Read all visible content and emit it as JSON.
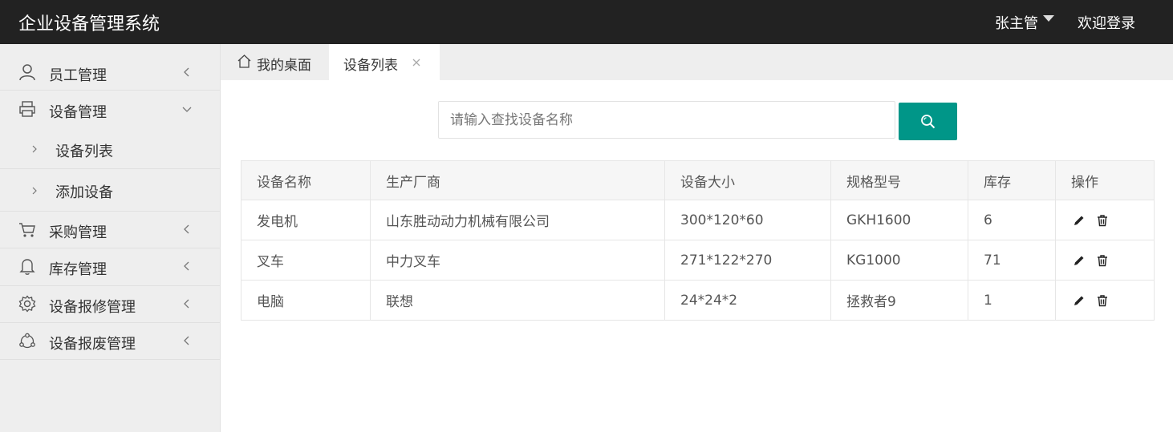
{
  "header": {
    "app_title": "企业设备管理系统",
    "user_name": "张主管",
    "welcome": "欢迎登录"
  },
  "sidebar": {
    "items": [
      {
        "label": "员工管理",
        "icon": "user-icon"
      },
      {
        "label": "设备管理",
        "icon": "printer-icon",
        "expanded": true
      },
      {
        "label": "设备列表",
        "sub": true
      },
      {
        "label": "添加设备",
        "sub": true
      },
      {
        "label": "采购管理",
        "icon": "cart-icon"
      },
      {
        "label": "库存管理",
        "icon": "bell-icon"
      },
      {
        "label": "设备报修管理",
        "icon": "gear-icon"
      },
      {
        "label": "设备报废管理",
        "icon": "share-icon"
      }
    ]
  },
  "tabs": [
    {
      "label": "我的桌面",
      "icon": "home-icon"
    },
    {
      "label": "设备列表",
      "active": true
    }
  ],
  "search": {
    "placeholder": "请输入查找设备名称",
    "button_icon": "search-icon",
    "button_color": "#009688"
  },
  "table": {
    "headers": [
      "设备名称",
      "生产厂商",
      "设备大小",
      "规格型号",
      "库存",
      "操作"
    ],
    "rows": [
      [
        "发电机",
        "山东胜动动力机械有限公司",
        "300*120*60",
        "GKH1600",
        "6"
      ],
      [
        "叉车",
        "中力叉车",
        "271*122*270",
        "KG1000",
        "71"
      ],
      [
        "电脑",
        "联想",
        "24*24*2",
        "拯救者9",
        "1"
      ]
    ],
    "actions": [
      "edit-icon",
      "delete-icon"
    ]
  }
}
